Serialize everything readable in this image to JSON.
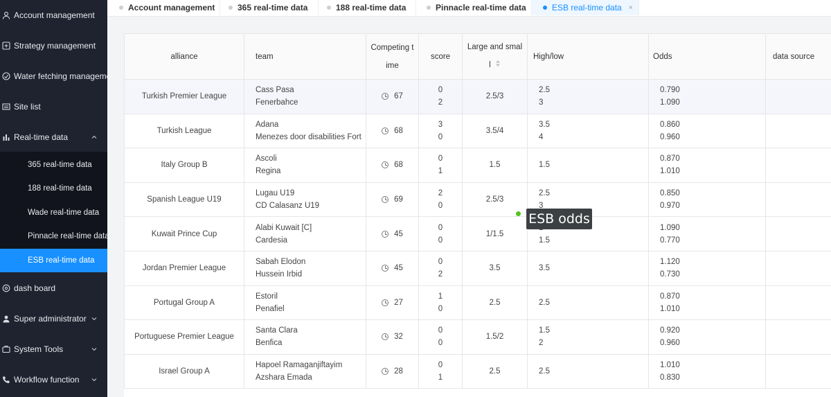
{
  "sidebar": {
    "menu": [
      {
        "label": "Account management",
        "icon": "user-icon",
        "arrow": false
      },
      {
        "label": "Strategy management",
        "icon": "strategy-icon",
        "arrow": false
      },
      {
        "label": "Water fetching management",
        "icon": "water-icon",
        "arrow": false
      },
      {
        "label": "Site list",
        "icon": "list-icon",
        "arrow": false
      },
      {
        "label": "Real-time data",
        "icon": "bar-chart-icon",
        "arrow": "up"
      }
    ],
    "submenu": [
      {
        "label": "365 real-time data",
        "active": false
      },
      {
        "label": "188 real-time data",
        "active": false
      },
      {
        "label": "Wade real-time data",
        "active": false
      },
      {
        "label": "Pinnacle real-time data",
        "active": false
      },
      {
        "label": "ESB real-time data",
        "active": true
      }
    ],
    "menu_bottom": [
      {
        "label": "dash board",
        "icon": "dashboard-icon",
        "arrow": false
      },
      {
        "label": "Super administrator",
        "icon": "admin-icon",
        "arrow": "down"
      },
      {
        "label": "System Tools",
        "icon": "tools-icon",
        "arrow": "down"
      },
      {
        "label": "Workflow function",
        "icon": "phone-icon",
        "arrow": "down"
      }
    ]
  },
  "tabs": [
    {
      "label": "Account management",
      "active": false
    },
    {
      "label": "365 real-time data",
      "active": false
    },
    {
      "label": "188 real-time data",
      "active": false
    },
    {
      "label": "Pinnacle real-time data",
      "active": false
    },
    {
      "label": "ESB real-time data",
      "active": true,
      "close": "×"
    }
  ],
  "table": {
    "headers": {
      "alliance": "alliance",
      "team": "team",
      "competing_time_1": "Competing t",
      "competing_time_2": "ime",
      "score": "score",
      "large_small_1": "Large and smal",
      "large_small_2": "l",
      "high_low": "High/low",
      "odds": "Odds",
      "data_source": "data source"
    },
    "rows": [
      {
        "alliance": "Turkish Premier League",
        "team1": "Cass Pasa",
        "team2": "Fenerbahce",
        "time": "67",
        "score1": "0",
        "score2": "2",
        "large_small": "2.5/3",
        "hl1": "2.5",
        "hl2": "3",
        "odds1": "0.790",
        "odds2": "1.090",
        "highlight": true
      },
      {
        "alliance": "Turkish League",
        "team1": "Adana",
        "team2": "Menezes door disabilities Fort",
        "time": "68",
        "score1": "3",
        "score2": "0",
        "large_small": "3.5/4",
        "hl1": "3.5",
        "hl2": "4",
        "odds1": "0.860",
        "odds2": "0.960",
        "highlight": false
      },
      {
        "alliance": "Italy Group B",
        "team1": "Ascoli",
        "team2": "Regina",
        "time": "68",
        "score1": "0",
        "score2": "1",
        "large_small": "1.5",
        "hl1": "1.5",
        "hl2": "",
        "odds1": "0.870",
        "odds2": "1.010",
        "highlight": false
      },
      {
        "alliance": "Spanish League U19",
        "team1": "Lugau U19",
        "team2": "CD Calasanz U19",
        "time": "69",
        "score1": "2",
        "score2": "0",
        "large_small": "2.5/3",
        "hl1": "2.5",
        "hl2": "3",
        "odds1": "0.850",
        "odds2": "0.970",
        "highlight": false
      },
      {
        "alliance": "Kuwait Prince Cup",
        "team1": "Alabi Kuwait [C]",
        "team2": "Cardesia",
        "time": "45",
        "score1": "0",
        "score2": "0",
        "large_small": "1/1.5",
        "hl1": "1",
        "hl2": "1.5",
        "odds1": "1.090",
        "odds2": "0.770",
        "highlight": false
      },
      {
        "alliance": "Jordan Premier League",
        "team1": "Sabah Elodon",
        "team2": "Hussein Irbid",
        "time": "45",
        "score1": "0",
        "score2": "2",
        "large_small": "3.5",
        "hl1": "3.5",
        "hl2": "",
        "odds1": "1.120",
        "odds2": "0.730",
        "highlight": false
      },
      {
        "alliance": "Portugal Group A",
        "team1": "Estoril",
        "team2": "Penafiel",
        "time": "27",
        "score1": "1",
        "score2": "0",
        "large_small": "2.5",
        "hl1": "2.5",
        "hl2": "",
        "odds1": "0.870",
        "odds2": "1.010",
        "highlight": false
      },
      {
        "alliance": "Portuguese Premier League",
        "team1": "Santa Clara",
        "team2": "Benfica",
        "time": "32",
        "score1": "0",
        "score2": "0",
        "large_small": "1.5/2",
        "hl1": "1.5",
        "hl2": "2",
        "odds1": "0.920",
        "odds2": "0.960",
        "highlight": false
      },
      {
        "alliance": "Israel Group A",
        "team1": "Hapoel Ramaganjiftayim",
        "team2": "Azshara Emada",
        "time": "28",
        "score1": "0",
        "score2": "1",
        "large_small": "2.5",
        "hl1": "2.5",
        "hl2": "",
        "odds1": "1.010",
        "odds2": "0.830",
        "highlight": false
      }
    ]
  },
  "tooltip": {
    "text": "ESB odds"
  },
  "colors": {
    "sidebar": "#1f2330",
    "submenu": "#11141c",
    "accent": "#1890ff",
    "tooltip": "#3d4043",
    "status_dot": "#52c41a"
  }
}
